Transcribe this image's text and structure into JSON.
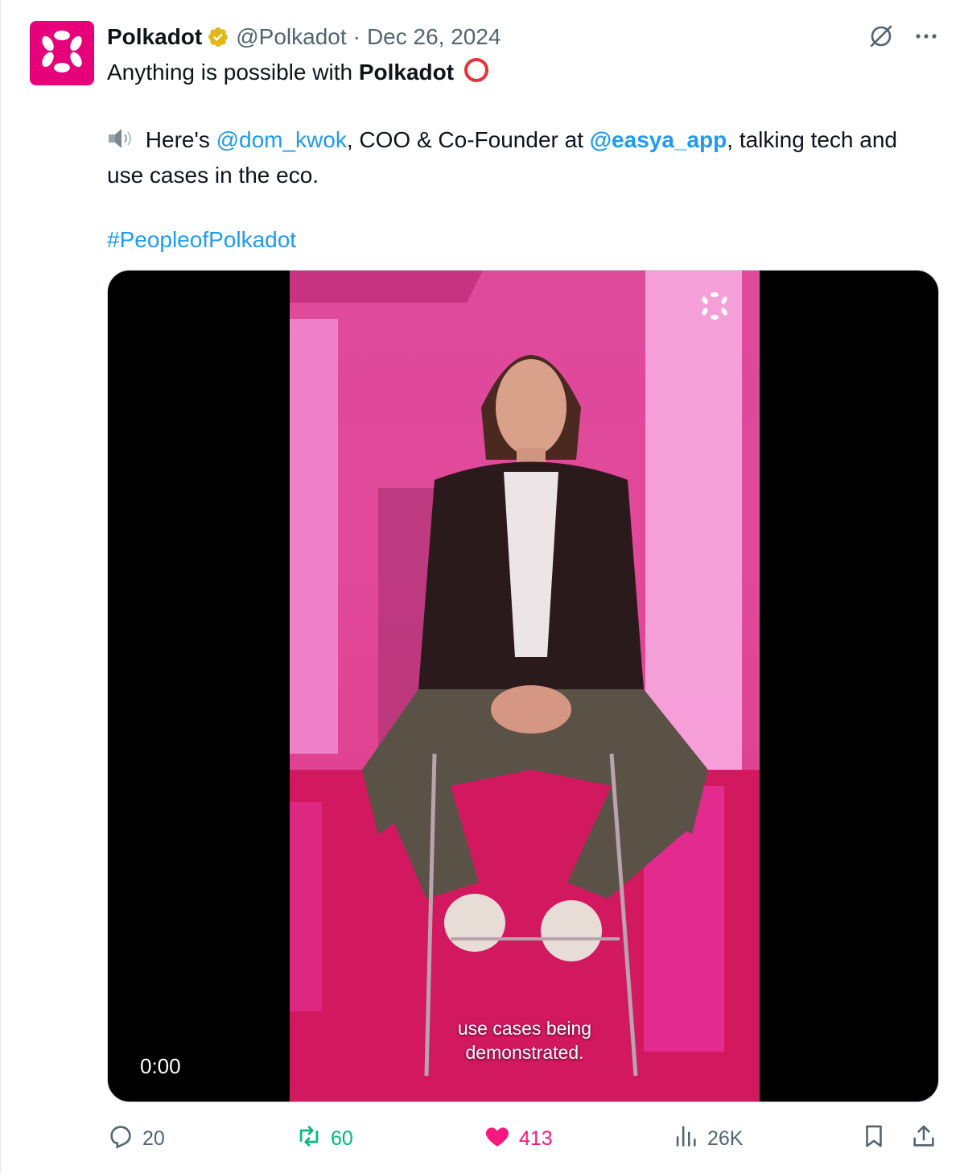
{
  "author": {
    "display_name": "Polkadot",
    "handle": "@Polkadot",
    "separator": "·",
    "date": "Dec 26, 2024"
  },
  "tweet": {
    "line1_prefix": "Anything is possible with ",
    "line1_bold": "Polkadot",
    "line2_speaker": "🔉",
    "line2_a": " Here's ",
    "mention1": "@dom_kwok",
    "line2_b": ", COO & Co-Founder at ",
    "mention2": "@easya_app",
    "line2_c": ", talking tech and use cases in the eco.",
    "hashtag": "#PeopleofPolkadot"
  },
  "video": {
    "time": "0:00",
    "subtitle_line1": "use cases being",
    "subtitle_line2": "demonstrated."
  },
  "actions": {
    "replies": "20",
    "reposts": "60",
    "likes": "413",
    "views": "26K"
  },
  "colors": {
    "brand": "#e6007a",
    "link": "#1d9bf0",
    "repost": "#00ba7c",
    "like": "#f91880",
    "muted": "#536471"
  },
  "icons": [
    "polkadot-logo-icon",
    "verified-badge-icon",
    "grok-icon",
    "more-icon",
    "reply-icon",
    "repost-icon",
    "like-icon",
    "views-icon",
    "bookmark-icon",
    "share-icon"
  ]
}
